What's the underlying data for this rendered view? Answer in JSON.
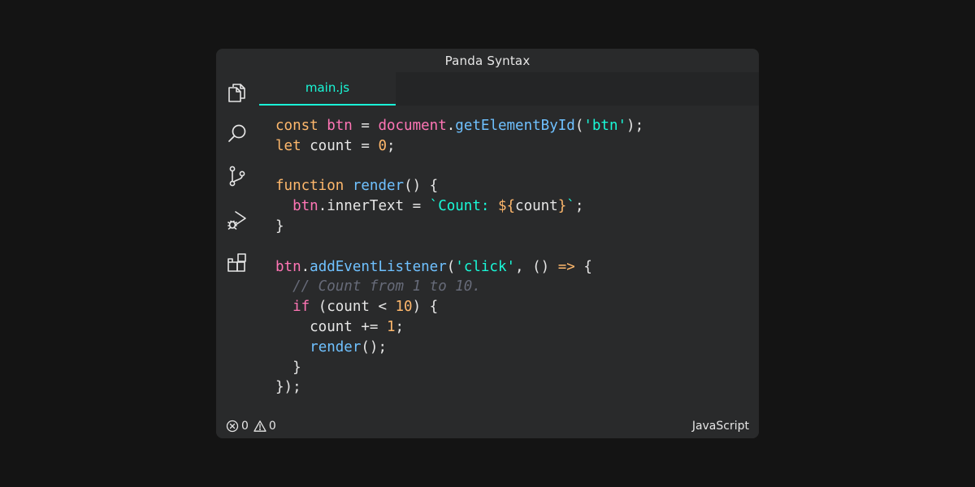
{
  "window": {
    "title": "Panda Syntax"
  },
  "activity_bar": {
    "icons": [
      "explorer-icon",
      "search-icon",
      "source-control-icon",
      "run-debug-icon",
      "extensions-icon"
    ]
  },
  "tabs": [
    {
      "label": "main.js",
      "active": true
    }
  ],
  "editor": {
    "language": "JavaScript",
    "lines": [
      [
        {
          "t": "const",
          "k": "kw"
        },
        {
          "t": " "
        },
        {
          "t": "btn",
          "k": "var"
        },
        {
          "t": " = "
        },
        {
          "t": "document",
          "k": "var"
        },
        {
          "t": "."
        },
        {
          "t": "getElementById",
          "k": "fn"
        },
        {
          "t": "("
        },
        {
          "t": "'btn'",
          "k": "str"
        },
        {
          "t": ");"
        }
      ],
      [
        {
          "t": "let",
          "k": "kw"
        },
        {
          "t": " count = "
        },
        {
          "t": "0",
          "k": "num"
        },
        {
          "t": ";"
        }
      ],
      [],
      [
        {
          "t": "function",
          "k": "kw"
        },
        {
          "t": " "
        },
        {
          "t": "render",
          "k": "fn"
        },
        {
          "t": "() {"
        }
      ],
      [
        {
          "t": "  "
        },
        {
          "t": "btn",
          "k": "var"
        },
        {
          "t": ".innerText = "
        },
        {
          "t": "`Count: ",
          "k": "str"
        },
        {
          "t": "${",
          "k": "interp"
        },
        {
          "t": "count"
        },
        {
          "t": "}",
          "k": "interp"
        },
        {
          "t": "`",
          "k": "str"
        },
        {
          "t": ";"
        }
      ],
      [
        {
          "t": "}"
        }
      ],
      [],
      [
        {
          "t": "btn",
          "k": "var"
        },
        {
          "t": "."
        },
        {
          "t": "addEventListener",
          "k": "fn"
        },
        {
          "t": "("
        },
        {
          "t": "'click'",
          "k": "str"
        },
        {
          "t": ", () "
        },
        {
          "t": "=>",
          "k": "arrow"
        },
        {
          "t": " {"
        }
      ],
      [
        {
          "t": "  "
        },
        {
          "t": "// Count from 1 to 10.",
          "k": "cm"
        }
      ],
      [
        {
          "t": "  "
        },
        {
          "t": "if",
          "k": "var"
        },
        {
          "t": " (count < "
        },
        {
          "t": "10",
          "k": "num"
        },
        {
          "t": ") {"
        }
      ],
      [
        {
          "t": "    count += "
        },
        {
          "t": "1",
          "k": "num"
        },
        {
          "t": ";"
        }
      ],
      [
        {
          "t": "    "
        },
        {
          "t": "render",
          "k": "fn"
        },
        {
          "t": "();"
        }
      ],
      [
        {
          "t": "  }"
        }
      ],
      [
        {
          "t": "});"
        }
      ]
    ]
  },
  "status_bar": {
    "errors_icon": "error-circle-icon",
    "errors_count": "0",
    "warnings_icon": "warning-triangle-icon",
    "warnings_count": "0",
    "language": "JavaScript"
  },
  "colors": {
    "background": "#141414",
    "window": "#292a2b",
    "tab_strip": "#242526",
    "accent": "#19f9d8",
    "keyword": "#ffb86c",
    "variable": "#ff75b5",
    "function": "#6fc1ff",
    "string": "#19f9d8",
    "comment": "#676b79",
    "text": "#e6e6e6"
  }
}
